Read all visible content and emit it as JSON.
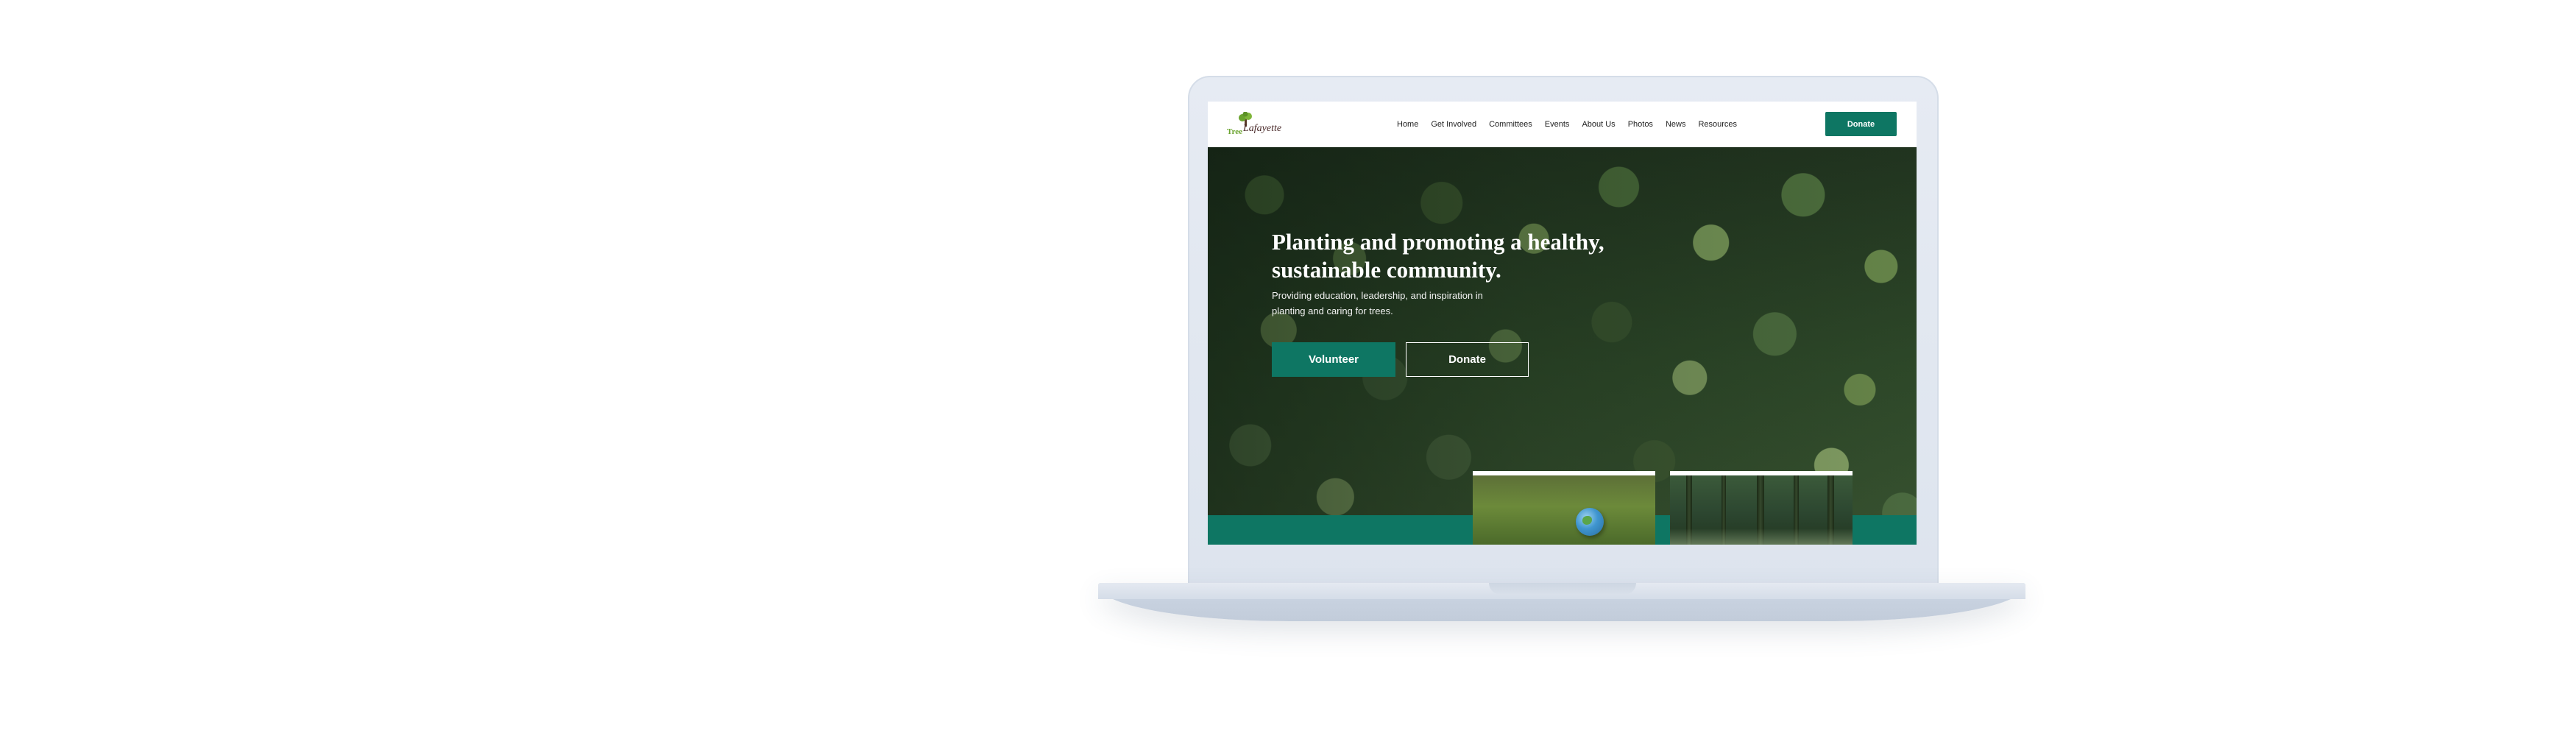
{
  "header": {
    "logo": {
      "word_tree": "Tree",
      "word_lafayette": "Lafayette"
    },
    "nav": [
      {
        "id": "home",
        "label": "Home"
      },
      {
        "id": "get-involved",
        "label": "Get Involved"
      },
      {
        "id": "committees",
        "label": "Committees"
      },
      {
        "id": "events",
        "label": "Events"
      },
      {
        "id": "about-us",
        "label": "About Us"
      },
      {
        "id": "photos",
        "label": "Photos"
      },
      {
        "id": "news",
        "label": "News"
      },
      {
        "id": "resources",
        "label": "Resources"
      }
    ],
    "donate_label": "Donate"
  },
  "hero": {
    "heading": "Planting and promoting a healthy, sustainable community.",
    "subheading": "Providing education, leadership, and inspiration in planting and caring for trees.",
    "primary_button": "Volunteer",
    "secondary_button": "Donate"
  },
  "colors": {
    "brand_green": "#0e7663",
    "logo_leaf_green": "#6aa32e",
    "logo_text_brown": "#4a2a2a"
  },
  "icons": {
    "logo": "tree-icon"
  }
}
